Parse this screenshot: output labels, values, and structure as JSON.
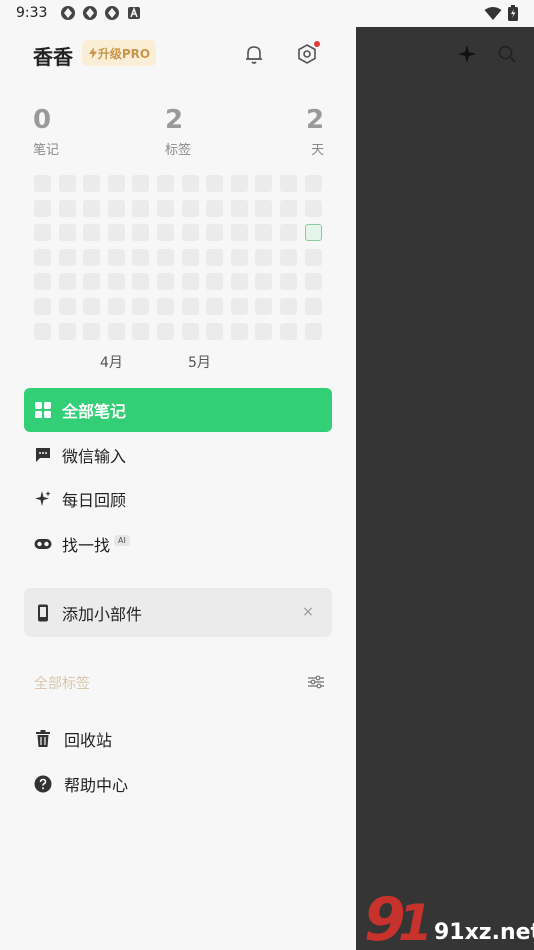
{
  "status_bar": {
    "time": "9:33"
  },
  "header": {
    "title": "香香",
    "pro_label": "升级PRO"
  },
  "stats": [
    {
      "value": "0",
      "label": "笔记"
    },
    {
      "value": "2",
      "label": "标签"
    },
    {
      "value": "2",
      "label": "天"
    }
  ],
  "heatmap": {
    "months": [
      "4月",
      "5月"
    ]
  },
  "nav": {
    "all_notes": "全部笔记",
    "wechat_input": "微信输入",
    "daily_review": "每日回顾",
    "search": "找一找",
    "search_badge": "AI"
  },
  "widget_card": {
    "label": "添加小部件",
    "close": "×"
  },
  "tags": {
    "title": "全部标签"
  },
  "bottom": {
    "recycle": "回收站",
    "help": "帮助中心"
  },
  "watermark": {
    "text": "91xz.net"
  },
  "colors": {
    "accent": "#32cf76",
    "pro_text": "#c9964a",
    "pro_bg": "#fbeed7",
    "overlay": "#353535"
  }
}
